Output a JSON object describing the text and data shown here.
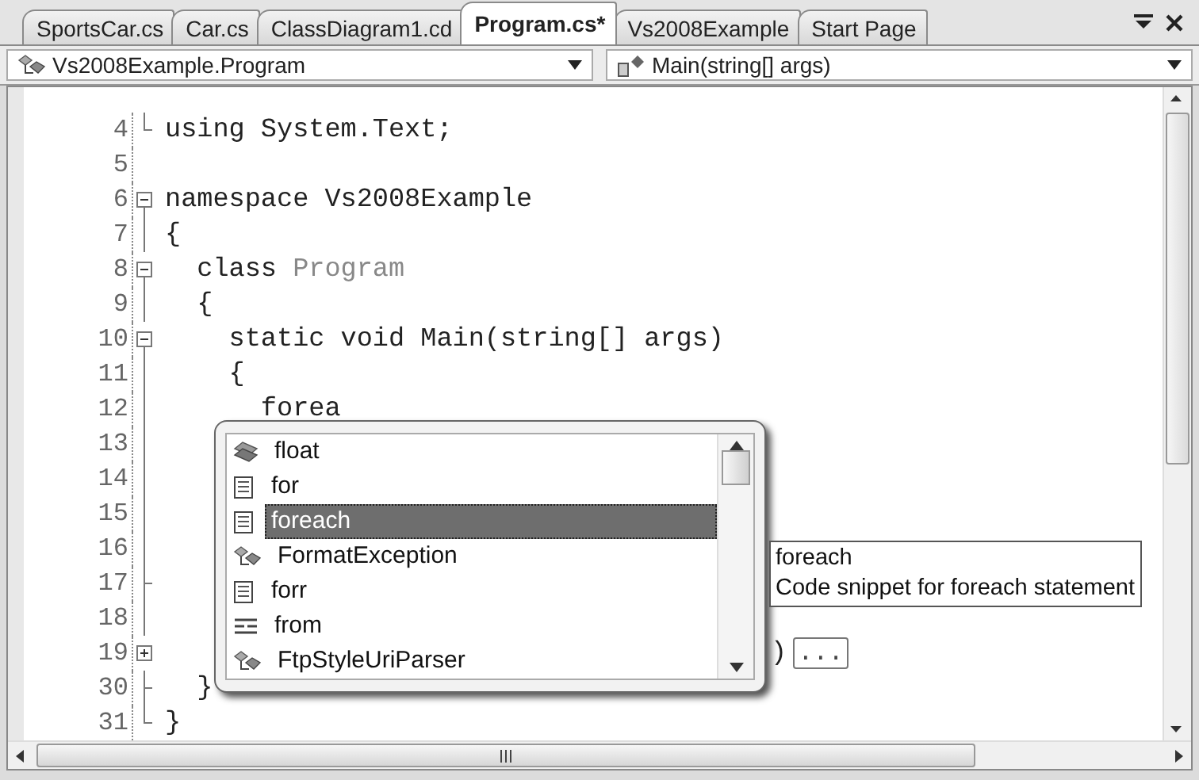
{
  "tabs": [
    {
      "label": "SportsCar.cs",
      "selected": false
    },
    {
      "label": "Car.cs",
      "selected": false
    },
    {
      "label": "ClassDiagram1.cd",
      "selected": false
    },
    {
      "label": "Program.cs*",
      "selected": true
    },
    {
      "label": "Vs2008Example",
      "selected": false
    },
    {
      "label": "Start Page",
      "selected": false
    }
  ],
  "navigation": {
    "type_dropdown": "Vs2008Example.Program",
    "member_dropdown": "Main(string[] args)"
  },
  "code_lines": [
    {
      "number": "4",
      "kind": "end",
      "segments": [
        {
          "text": "using System.Text;",
          "kind": "plain"
        }
      ]
    },
    {
      "number": "5",
      "kind": "plain"
    },
    {
      "number": "6",
      "kind": "start",
      "segments": [
        {
          "text": "namespace Vs2008Example",
          "kind": "plain"
        }
      ]
    },
    {
      "number": "7",
      "kind": "line",
      "segments": [
        {
          "text": "{",
          "kind": "plain"
        }
      ]
    },
    {
      "number": "8",
      "kind": "start",
      "segments": [
        {
          "text": "  class ",
          "kind": "plain"
        },
        {
          "text": "Program",
          "kind": "type"
        }
      ]
    },
    {
      "number": "9",
      "kind": "line",
      "segments": [
        {
          "text": "  {",
          "kind": "plain"
        }
      ]
    },
    {
      "number": "10",
      "kind": "start",
      "segments": [
        {
          "text": "    static void Main(string[] args)",
          "kind": "plain"
        }
      ]
    },
    {
      "number": "11",
      "kind": "line",
      "segments": [
        {
          "text": "    {",
          "kind": "plain"
        }
      ]
    },
    {
      "number": "12",
      "kind": "line",
      "segments": [
        {
          "text": "      forea",
          "kind": "plain"
        }
      ]
    },
    {
      "number": "13",
      "kind": "line"
    },
    {
      "number": "14",
      "kind": "line"
    },
    {
      "number": "15",
      "kind": "line"
    },
    {
      "number": "16",
      "kind": "line"
    },
    {
      "number": "17",
      "kind": "tee"
    },
    {
      "number": "18",
      "kind": "line"
    },
    {
      "number": "19",
      "kind": "collapsed",
      "segments": [
        {
          "text": ")",
          "kind": "tail"
        },
        {
          "text": "...",
          "kind": "collapsed"
        }
      ]
    },
    {
      "number": "30",
      "kind": "tee",
      "segments": [
        {
          "text": "  }",
          "kind": "plain"
        }
      ]
    },
    {
      "number": "31",
      "kind": "end",
      "segments": [
        {
          "text": "}",
          "kind": "plain"
        }
      ]
    }
  ],
  "completion_list": {
    "items": [
      {
        "label": "float",
        "kind": "keyword",
        "selected": false
      },
      {
        "label": "for",
        "kind": "snippet",
        "selected": false
      },
      {
        "label": "foreach",
        "kind": "snippet",
        "selected": true
      },
      {
        "label": "FormatException",
        "kind": "class",
        "selected": false
      },
      {
        "label": "forr",
        "kind": "snippet",
        "selected": false
      },
      {
        "label": "from",
        "kind": "query",
        "selected": false
      },
      {
        "label": "FtpStyleUriParser",
        "kind": "class",
        "selected": false
      }
    ]
  },
  "tooltip": {
    "title": "foreach",
    "description": "Code snippet for foreach statement"
  }
}
